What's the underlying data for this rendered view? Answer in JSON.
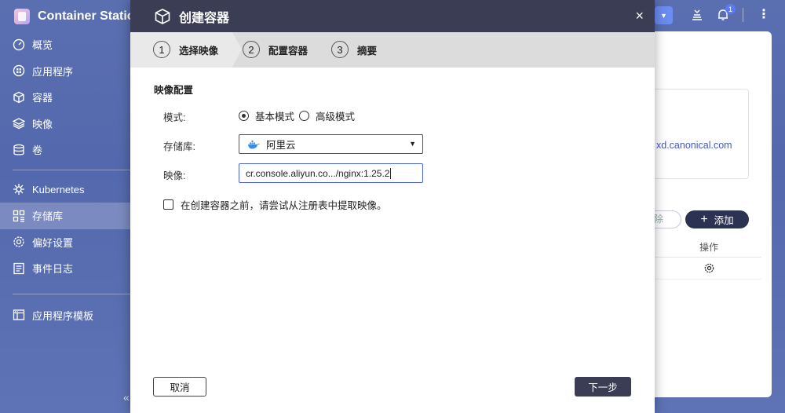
{
  "app": {
    "title": "Container Statio"
  },
  "sidebar": {
    "items": [
      {
        "label": "概览",
        "icon": "dashboard-icon"
      },
      {
        "label": "应用程序",
        "icon": "apps-icon"
      },
      {
        "label": "容器",
        "icon": "cube-icon"
      },
      {
        "label": "映像",
        "icon": "layers-icon"
      },
      {
        "label": "卷",
        "icon": "database-icon"
      },
      {
        "label": "Kubernetes",
        "icon": "kubernetes-icon"
      },
      {
        "label": "存储库",
        "icon": "repository-icon",
        "active": true
      },
      {
        "label": "偏好设置",
        "icon": "gear-icon"
      },
      {
        "label": "事件日志",
        "icon": "log-icon"
      },
      {
        "label": "应用程序模板",
        "icon": "template-icon"
      }
    ],
    "collapse": "«"
  },
  "header": {
    "notification_count": "1",
    "more": "⋮"
  },
  "background": {
    "link": "xd.canonical.com",
    "delete_label": "除",
    "add_label": "添加",
    "actions_header": "操作"
  },
  "dialog": {
    "title": "创建容器",
    "close": "×",
    "steps": [
      {
        "num": "1",
        "label": "选择映像"
      },
      {
        "num": "2",
        "label": "配置容器"
      },
      {
        "num": "3",
        "label": "摘要"
      }
    ],
    "section_title": "映像配置",
    "mode": {
      "label": "模式:",
      "options": [
        "基本模式",
        "高级模式"
      ],
      "selected": "基本模式"
    },
    "registry": {
      "label": "存储库:",
      "value": "阿里云"
    },
    "image": {
      "label": "映像:",
      "value": "cr.console.aliyun.co.../nginx:1.25.2"
    },
    "pull_option": {
      "label": "在创建容器之前，请尝试从注册表中提取映像。",
      "checked": false
    },
    "cancel_label": "取消",
    "next_label": "下一步"
  },
  "colors": {
    "accent": "#4b63d9",
    "header_dark": "#3b3d54",
    "sidebar_bg": "#5a6fb0"
  }
}
